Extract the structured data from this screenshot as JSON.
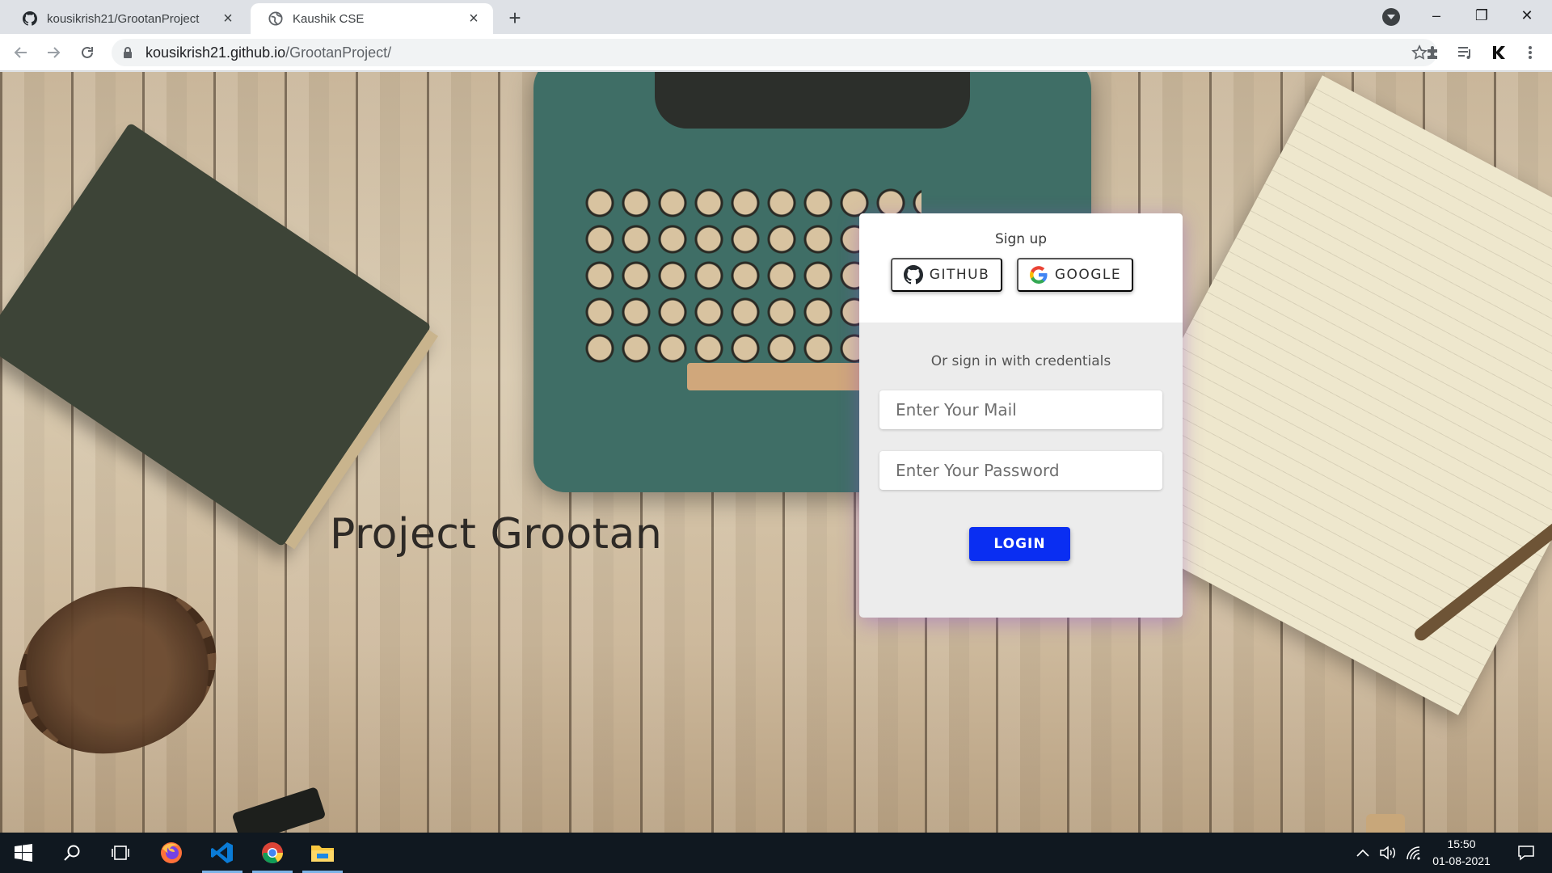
{
  "browser": {
    "tabs": [
      {
        "title": "kousikrish21/GrootanProject",
        "favicon": "github-icon",
        "active": false
      },
      {
        "title": "Kaushik CSE",
        "favicon": "globe-icon",
        "active": true
      }
    ],
    "address": {
      "host": "kousikrish21.github.io",
      "path": "/GrootanProject/"
    }
  },
  "page": {
    "title": "Project Grootan"
  },
  "login_card": {
    "signup_label": "Sign up",
    "github_label": "GITHUB",
    "google_label": "GOOGLE",
    "divider_text": "Or sign in with credentials",
    "mail_placeholder": "Enter Your Mail",
    "password_placeholder": "Enter Your Password",
    "login_label": "LOGIN",
    "login_color": "#0a2ef2"
  },
  "taskbar": {
    "apps": [
      "windows-start-icon",
      "search-icon",
      "task-view-icon",
      "firefox-icon",
      "vscode-icon",
      "chrome-icon",
      "file-explorer-icon"
    ],
    "time": "15:50",
    "date": "01-08-2021"
  }
}
